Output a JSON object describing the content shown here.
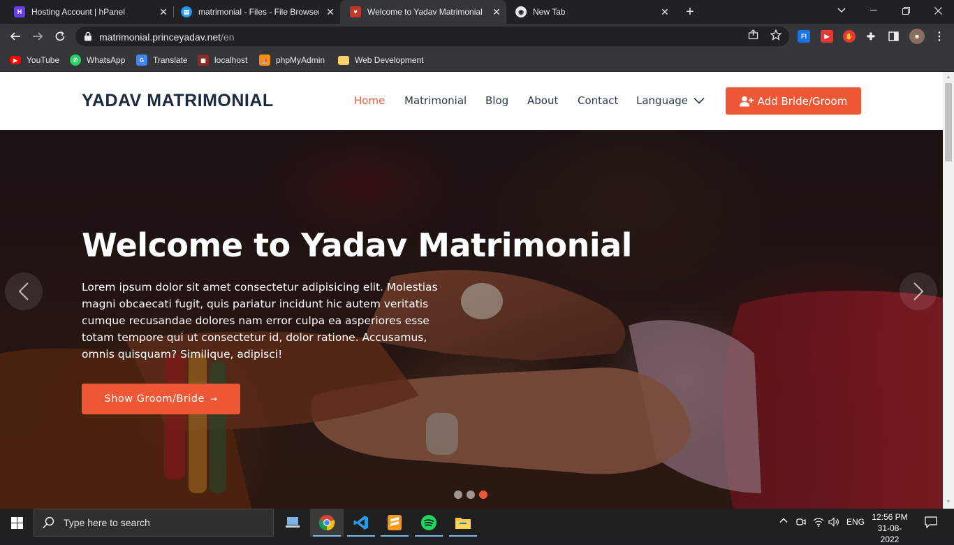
{
  "browser": {
    "tabs": [
      {
        "title": "Hosting Account | hPanel",
        "icon": "hostinger-icon",
        "color": "#673de6"
      },
      {
        "title": "matrimonial - Files - File Browser",
        "icon": "file-browser-icon",
        "color": "#2196f3"
      },
      {
        "title": "Welcome to Yadav Matrimonial S",
        "icon": "site-favicon-icon",
        "color": "#c0392b"
      },
      {
        "title": "New Tab",
        "icon": "chrome-icon",
        "color": "#e8eaed"
      }
    ],
    "close_glyph": "✕",
    "new_tab_glyph": "+",
    "url_host": "matrimonial.princeyadav.net",
    "url_path": "/en",
    "bookmarks": [
      {
        "label": "YouTube",
        "icon": "youtube-icon",
        "color": "#ff0000"
      },
      {
        "label": "WhatsApp",
        "icon": "whatsapp-icon",
        "color": "#25d366"
      },
      {
        "label": "Translate",
        "icon": "translate-icon",
        "color": "#4285f4"
      },
      {
        "label": "localhost",
        "icon": "localhost-icon",
        "color": "#8b2a2a"
      },
      {
        "label": "phpMyAdmin",
        "icon": "phpmyadmin-icon",
        "color": "#f29111"
      },
      {
        "label": "Web Development",
        "icon": "folder-icon",
        "color": "#f6d06b"
      }
    ]
  },
  "site": {
    "logo": "YADAV MATRIMONIAL",
    "nav": [
      "Home",
      "Matrimonial",
      "Blog",
      "About",
      "Contact"
    ],
    "language_label": "Language",
    "cta_label": "Add Bride/Groom",
    "accent_color": "#ef5836"
  },
  "hero": {
    "title": "Welcome to Yadav Matrimonial",
    "text": "Lorem ipsum dolor sit amet consectetur adipisicing elit. Molestias magni obcaecati fugit, quis pariatur incidunt hic autem veritatis cumque recusandae dolores nam error culpa ea asperiores esse totam tempore qui ut consectetur id, dolor ratione. Accusamus, omnis quisquam? Similique, adipisci!",
    "button_label": "Show Groom/Bride",
    "button_arrow": "→",
    "slide_count": 3,
    "active_slide": 3
  },
  "taskbar": {
    "search_placeholder": "Type here to search",
    "apps": [
      "network-app-icon",
      "chrome-icon",
      "vscode-icon",
      "sublime-text-icon",
      "spotify-icon",
      "file-explorer-icon"
    ],
    "language": "ENG",
    "time": "12:56 PM",
    "date": "31-08-2022"
  }
}
